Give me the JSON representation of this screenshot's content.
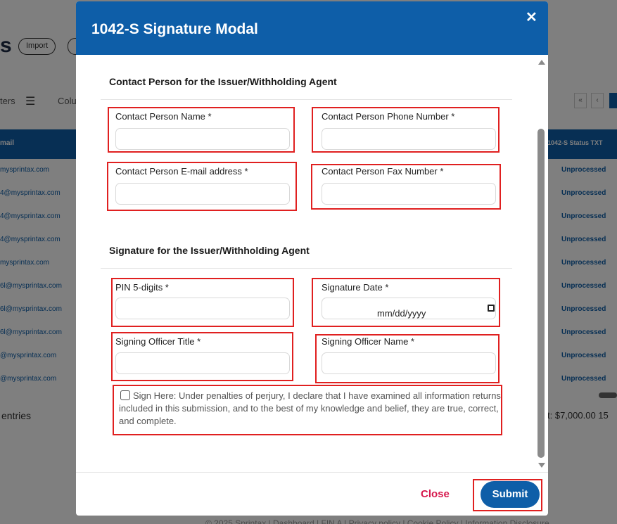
{
  "modal": {
    "title": "1042-S Signature Modal",
    "close_icon": "✕",
    "section1_title": "Contact Person for the Issuer/Withholding Agent",
    "section2_title": "Signature for the Issuer/Withholding Agent",
    "fields": {
      "contact_name": {
        "label": "Contact Person Name *",
        "value": ""
      },
      "contact_phone": {
        "label": "Contact Person Phone Number *",
        "value": ""
      },
      "contact_email": {
        "label": "Contact Person E-mail address *",
        "value": ""
      },
      "contact_fax": {
        "label": "Contact Person Fax Number *",
        "value": ""
      },
      "pin": {
        "label": "PIN 5-digits *",
        "value": ""
      },
      "signature_date": {
        "label": "Signature Date *",
        "placeholder": "mm/dd/yyyy"
      },
      "officer_title": {
        "label": "Signing Officer Title *",
        "value": ""
      },
      "officer_name": {
        "label": "Signing Officer Name *",
        "value": ""
      }
    },
    "sign_here_text": "Sign Here: Under penalties of perjury, I declare that I have examined all information returns included in this submission, and to the best of my knowledge and belief, they are true, correct, and complete.",
    "sign_here_checked": false,
    "close_label": "Close",
    "submit_label": "Submit"
  },
  "background": {
    "title_fragment": "s",
    "import_label": "Import",
    "filters_label": "ters",
    "columns_label": "Colu",
    "table_header_left": "mail",
    "table_header_right": "1042-S Status TXT",
    "rows": [
      {
        "email": "mysprintax.com",
        "status": "Unprocessed"
      },
      {
        "email": "4@mysprintax.com",
        "status": "Unprocessed"
      },
      {
        "email": "4@mysprintax.com",
        "status": "Unprocessed"
      },
      {
        "email": "4@mysprintax.com",
        "status": "Unprocessed"
      },
      {
        "email": "mysprintax.com",
        "status": "Unprocessed"
      },
      {
        "email": "6l@mysprintax.com",
        "status": "Unprocessed"
      },
      {
        "email": "6l@mysprintax.com",
        "status": "Unprocessed"
      },
      {
        "email": "6l@mysprintax.com",
        "status": "Unprocessed"
      },
      {
        "email": "@mysprintax.com",
        "status": "Unprocessed"
      },
      {
        "email": "@mysprintax.com",
        "status": "Unprocessed"
      }
    ],
    "entries_label": "entries",
    "total_label": "t: $7,000.00  15",
    "footer_text": "© 2025 Sprintax | Dashboard | FIN A | Privacy policy | Cookie Policy | Information Disclosure"
  },
  "colors": {
    "primary": "#0e5ea8",
    "highlight_border": "#e02020",
    "close_text": "#d6174c"
  }
}
